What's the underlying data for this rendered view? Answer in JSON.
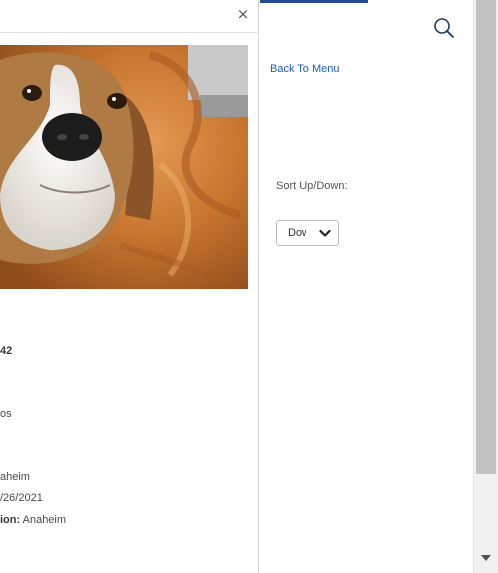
{
  "modal": {
    "close_glyph": "×",
    "photo_alt": "dog photo",
    "details": {
      "line1": "42",
      "line2": "os",
      "line3": "aheim",
      "line4": "/26/2021",
      "line5_label": "ion:",
      "line5_value": " Anaheim"
    }
  },
  "sidebar": {
    "back_link": "Back To Menu",
    "sort_label": "Sort Up/Down:",
    "sort_value": "Down",
    "search_icon": "search-icon",
    "accent_color": "#1f4e8c",
    "link_color": "#1f5fbf"
  }
}
